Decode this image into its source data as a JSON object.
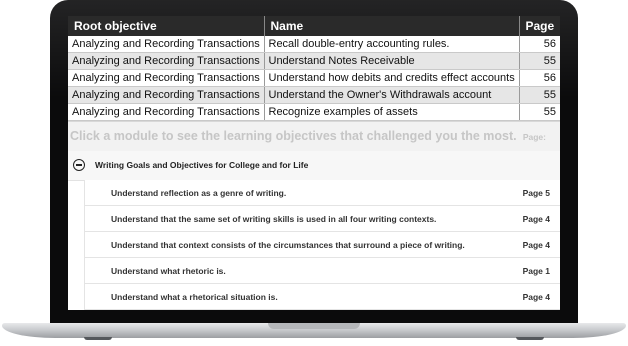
{
  "table": {
    "headers": [
      "Root objective",
      "Name",
      "Page"
    ],
    "rows": [
      {
        "root": "Analyzing and Recording Transactions",
        "name": "Recall double-entry accounting rules.",
        "page": "56"
      },
      {
        "root": "Analyzing and Recording Transactions",
        "name": "Understand Notes Receivable",
        "page": "55"
      },
      {
        "root": "Analyzing and Recording Transactions",
        "name": "Understand how debits and credits effect accounts",
        "page": "56"
      },
      {
        "root": "Analyzing and Recording Transactions",
        "name": "Understand the Owner's Withdrawals account",
        "page": "55"
      },
      {
        "root": "Analyzing and Recording Transactions",
        "name": "Recognize examples of assets",
        "page": "55"
      }
    ]
  },
  "prompt": {
    "text": "Click a module to see the learning objectives that challenged you the most.",
    "page_label": "Page:"
  },
  "module": {
    "title": "Writing Goals and Objectives for College and for Life",
    "toggle_icon": "minus-circle-icon",
    "objectives": [
      {
        "label": "Understand reflection as a genre of writing.",
        "page": "Page 5"
      },
      {
        "label": "Understand that the same set of writing skills is used in all four writing contexts.",
        "page": "Page 4"
      },
      {
        "label": "Understand that context consists of the circumstances that surround a piece of writing.",
        "page": "Page 4"
      },
      {
        "label": "Understand what rhetoric is.",
        "page": "Page 1"
      },
      {
        "label": "Understand what a rhetorical situation is.",
        "page": "Page 4"
      }
    ]
  }
}
